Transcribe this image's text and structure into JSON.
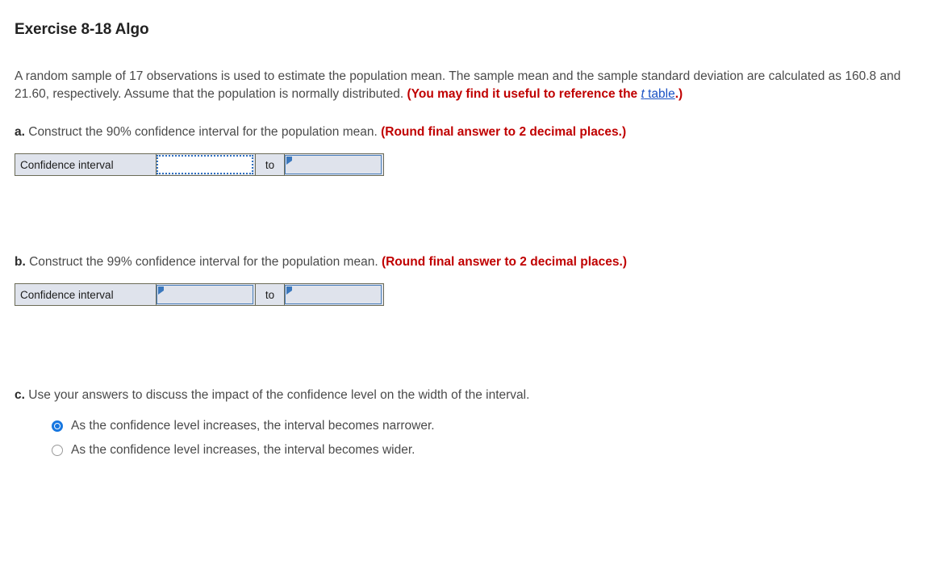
{
  "header": {
    "title": "Exercise 8-18 Algo"
  },
  "prompt": {
    "text_part1": "A random sample of 17 observations is used to estimate the population mean. The sample mean and the sample standard deviation are calculated as 160.8 and 21.60, respectively. Assume that the population is normally distributed. ",
    "hint_open": "(You may find it useful to reference the ",
    "link_italic": "t",
    "link_text": " table",
    "hint_close": ".)"
  },
  "parts": {
    "a": {
      "letter": "a.",
      "text": " Construct the 90% confidence interval for the population mean. ",
      "round_note": "(Round final answer to 2 decimal places.)",
      "row_label": "Confidence interval",
      "separator": "to",
      "lower_value": "",
      "upper_value": "",
      "lower_placeholder": "",
      "upper_placeholder": ""
    },
    "b": {
      "letter": "b.",
      "text": " Construct the 99% confidence interval for the population mean. ",
      "round_note": "(Round final answer to 2 decimal places.)",
      "row_label": "Confidence interval",
      "separator": "to",
      "lower_value": "",
      "upper_value": "",
      "lower_placeholder": "",
      "upper_placeholder": ""
    },
    "c": {
      "letter": "c.",
      "text": " Use your answers to discuss the impact of the confidence level on the width of the interval.",
      "options": [
        {
          "label": "As the confidence level increases, the interval becomes narrower.",
          "selected": true
        },
        {
          "label": "As the confidence level increases, the interval becomes wider.",
          "selected": false
        }
      ]
    }
  },
  "colors": {
    "accent_red": "#c00000",
    "link_blue": "#1a52c4",
    "radio_blue": "#1777e0",
    "field_border": "#4a7ebb",
    "cell_fill": "#dfe3ec",
    "table_border": "#6b6b57"
  }
}
